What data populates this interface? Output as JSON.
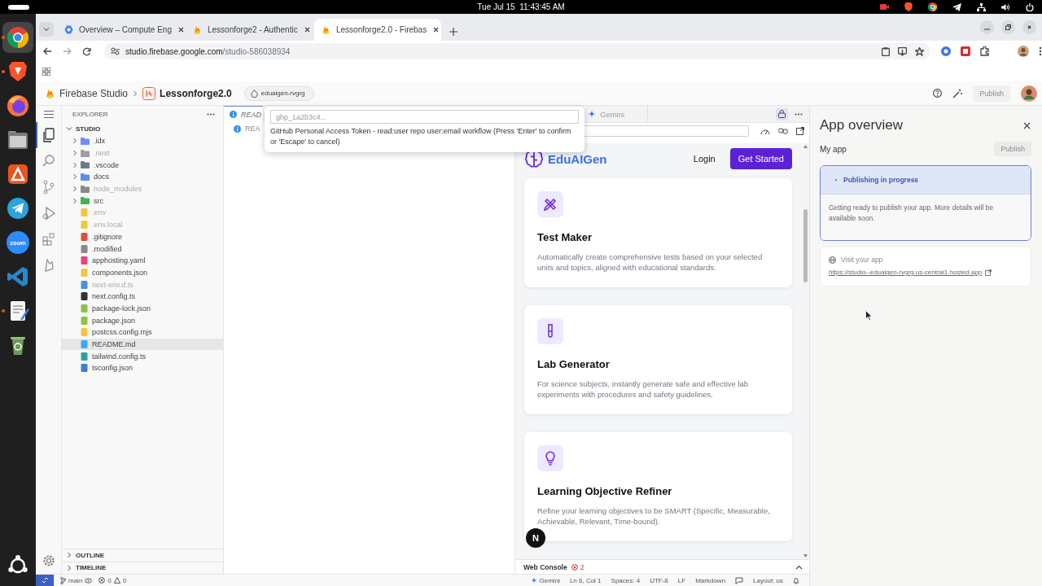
{
  "system_bar": {
    "clock": "Tue Jul 15  11:43:45 AM"
  },
  "dock": {
    "apps": [
      {
        "kind": "chrome",
        "selected": true,
        "running": true
      },
      {
        "kind": "brave",
        "selected": false,
        "running": true
      },
      {
        "kind": "firefox",
        "selected": false,
        "running": false
      },
      {
        "kind": "files",
        "selected": false,
        "running": false
      },
      {
        "kind": "appcenter",
        "selected": false,
        "running": false
      },
      {
        "kind": "telegram",
        "selected": false,
        "running": false
      },
      {
        "kind": "zoom",
        "label": "zoom",
        "selected": false,
        "running": false
      },
      {
        "kind": "vscode",
        "selected": false,
        "running": false
      },
      {
        "kind": "editor",
        "selected": false,
        "running": true
      },
      {
        "kind": "trash",
        "selected": false,
        "running": false
      }
    ]
  },
  "browser": {
    "tabs": [
      {
        "kind": "cloud",
        "title": "Overview – Compute Eng",
        "selected": false
      },
      {
        "kind": "firebase",
        "title": "Lessonforge2 - Authentic",
        "selected": false
      },
      {
        "kind": "firebase",
        "title": "Lessonforge2.0 - Firebas",
        "selected": true
      }
    ],
    "url": {
      "domain": "studio.firebase.google.com",
      "path": "/studio-586038934"
    }
  },
  "studio_header": {
    "product": "Firebase Studio",
    "project": "Lessonforge2.0",
    "workspace": "eduaigen-rvgrg",
    "publish_button": {
      "label": "Publish",
      "disabled": true
    }
  },
  "activity_bar": {
    "items": [
      {
        "kind": "explorer",
        "selected": true
      },
      {
        "kind": "search",
        "selected": false
      },
      {
        "kind": "source-control",
        "selected": false
      },
      {
        "kind": "run",
        "selected": false
      },
      {
        "kind": "extensions",
        "selected": false
      },
      {
        "kind": "firebase",
        "selected": false
      }
    ]
  },
  "explorer": {
    "title": "EXPLORER",
    "section": "STUDIO",
    "items": [
      {
        "kind": "folder",
        "label": ".idx",
        "expanded": false,
        "dimmed": false,
        "selected": false,
        "color": "#6c8ef5"
      },
      {
        "kind": "folder",
        "label": ".next",
        "expanded": false,
        "dimmed": true,
        "selected": false,
        "color": "#9e9e9e"
      },
      {
        "kind": "folder",
        "label": ".vscode",
        "expanded": false,
        "dimmed": false,
        "selected": false,
        "color": "#6d7a8a"
      },
      {
        "kind": "folder",
        "label": "docs",
        "expanded": false,
        "dimmed": false,
        "selected": false,
        "color": "#5b8def"
      },
      {
        "kind": "folder",
        "label": "node_modules",
        "expanded": false,
        "dimmed": true,
        "selected": false,
        "color": "#8a8a8a"
      },
      {
        "kind": "folder",
        "label": "src",
        "expanded": false,
        "dimmed": false,
        "selected": false,
        "color": "#4caf50"
      },
      {
        "kind": "file",
        "label": ".env",
        "dimmed": true,
        "selected": false,
        "color": "#f4c542"
      },
      {
        "kind": "file",
        "label": ".env.local",
        "dimmed": true,
        "selected": false,
        "color": "#f4c542"
      },
      {
        "kind": "file",
        "label": ".gitignore",
        "dimmed": false,
        "selected": false,
        "color": "#e44d3a"
      },
      {
        "kind": "file",
        "label": ".modified",
        "dimmed": false,
        "selected": false,
        "color": "#8a8a8a"
      },
      {
        "kind": "file",
        "label": "apphosting.yaml",
        "dimmed": false,
        "selected": false,
        "color": "#ec407a"
      },
      {
        "kind": "file",
        "label": "components.json",
        "dimmed": false,
        "selected": false,
        "color": "#f5c542"
      },
      {
        "kind": "file",
        "label": "next-env.d.ts",
        "dimmed": true,
        "selected": false,
        "color": "#4a90d9"
      },
      {
        "kind": "file",
        "label": "next.config.ts",
        "dimmed": false,
        "selected": false,
        "color": "#333333"
      },
      {
        "kind": "file",
        "label": "package-lock.json",
        "dimmed": false,
        "selected": false,
        "color": "#8bc34a"
      },
      {
        "kind": "file",
        "label": "package.json",
        "dimmed": false,
        "selected": false,
        "color": "#8bc34a"
      },
      {
        "kind": "file",
        "label": "postcss.config.mjs",
        "dimmed": false,
        "selected": false,
        "color": "#f5c542"
      },
      {
        "kind": "file",
        "label": "README.md",
        "dimmed": false,
        "selected": true,
        "color": "#42a5f5"
      },
      {
        "kind": "file",
        "label": "tailwind.config.ts",
        "dimmed": false,
        "selected": false,
        "color": "#26a69a"
      },
      {
        "kind": "file",
        "label": "tsconfig.json",
        "dimmed": false,
        "selected": false,
        "color": "#3f7ecb"
      }
    ],
    "panels": [
      {
        "label": "OUTLINE",
        "expanded": false
      },
      {
        "label": "TIMELINE",
        "expanded": false
      }
    ]
  },
  "editor": {
    "tab": {
      "label": "READ",
      "selected": true
    },
    "breadcrumb": "REA"
  },
  "quick_input": {
    "placeholder": "ghp_1a2b3c4...",
    "prompt": "GitHub Personal Access Token - read:user repo user:email workflow (Press 'Enter' to confirm or 'Escape' to cancel)"
  },
  "preview": {
    "tab": {
      "label": "Gemini"
    },
    "lock": {
      "on": true
    },
    "site": {
      "brand": "EduAIGen",
      "login": "Login",
      "cta": "Get Started",
      "dev_badge": "N",
      "cards": [
        {
          "kind": "ruler-pencil",
          "title": "Test Maker",
          "description": "Automatically create comprehensive tests based on your selected units and topics, aligned with educational standards."
        },
        {
          "kind": "test-tube",
          "title": "Lab Generator",
          "description": "For science subjects, instantly generate safe and effective lab experiments with procedures and safety guidelines."
        },
        {
          "kind": "lightbulb",
          "title": "Learning Objective Refiner",
          "description": "Refine your learning objectives to be SMART (Specific, Measurable, Achievable, Relevant, Time-bound)."
        }
      ]
    },
    "console": {
      "label": "Web Console",
      "errors": "2"
    }
  },
  "app_overview": {
    "title": "App overview",
    "app_label": "My app",
    "publish_button": {
      "label": "Publish",
      "disabled": true
    },
    "status": {
      "title": "Publishing in progress",
      "message": "Getting ready to publish your app. More details will be available soon."
    },
    "visit": {
      "label": "Visit your app",
      "url": "https://studio--eduaigen-rvgrg.us-central1.hosted.app"
    }
  },
  "status_bar": {
    "branch": "main",
    "errors": "0",
    "warnings": "0",
    "assistant": "Gemini",
    "items": [
      "Ln 6, Col 1",
      "Spaces: 4",
      "UTF-8",
      "LF",
      "Markdown"
    ],
    "layout": "Layout: us"
  }
}
